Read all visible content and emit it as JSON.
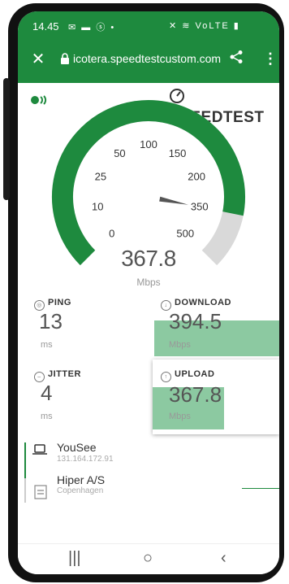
{
  "status_bar": {
    "time": "14.45",
    "icons_left": "✉ ▬ ⓢ •",
    "icons_right": "✕ ≋ VoLTE ▮"
  },
  "browser": {
    "close_icon": "close-icon",
    "url": "icotera.speedtestcustom.com"
  },
  "brand": {
    "name": "SPEEDTEST"
  },
  "gauge": {
    "ticks": [
      "0",
      "10",
      "25",
      "50",
      "100",
      "150",
      "200",
      "350",
      "500"
    ],
    "reading": "367.8",
    "unit": "Mbps",
    "needle_value": 350,
    "colors": {
      "arc": "#1e8a3e",
      "track": "#d9d9d9"
    }
  },
  "metrics": {
    "ping": {
      "label": "PING",
      "value": "13",
      "unit": "ms"
    },
    "download": {
      "label": "DOWNLOAD",
      "value": "394.5",
      "unit": "Mbps"
    },
    "jitter": {
      "label": "JITTER",
      "value": "4",
      "unit": "ms"
    },
    "upload": {
      "label": "UPLOAD",
      "value": "367.8",
      "unit": "Mbps"
    }
  },
  "servers": [
    {
      "name": "YouSee",
      "detail": "131.164.172.91"
    },
    {
      "name": "Hiper A/S",
      "detail": "Copenhagen"
    }
  ],
  "nav": {
    "recents": "|||",
    "home": "○",
    "back": "‹"
  }
}
